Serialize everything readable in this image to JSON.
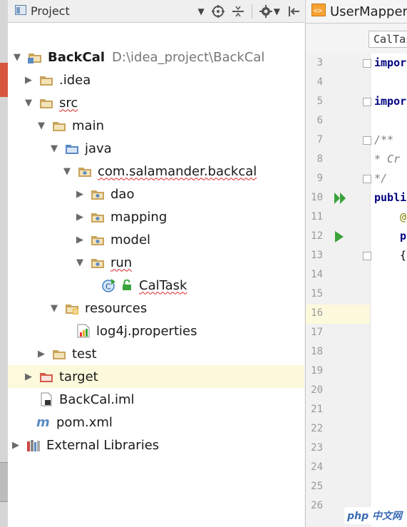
{
  "project_panel": {
    "title": "Project",
    "header_icons": [
      "dropdown-caret",
      "locate-icon",
      "collapse-icon",
      "gear-icon",
      "hide-icon"
    ]
  },
  "tree": [
    {
      "label": "BackCal",
      "path": "D:\\idea_project\\BackCal",
      "icon": "module-folder",
      "expanded": true,
      "bold": true
    },
    {
      "label": ".idea",
      "icon": "folder",
      "expanded": false
    },
    {
      "label": "src",
      "icon": "folder",
      "expanded": true,
      "squiggle": true
    },
    {
      "label": "main",
      "icon": "folder",
      "expanded": true
    },
    {
      "label": "java",
      "icon": "source-folder",
      "expanded": true
    },
    {
      "label": "com.salamander.backcal",
      "icon": "package",
      "expanded": true,
      "squiggle": true
    },
    {
      "label": "dao",
      "icon": "package",
      "expanded": false
    },
    {
      "label": "mapping",
      "icon": "package",
      "expanded": false
    },
    {
      "label": "model",
      "icon": "package",
      "expanded": false
    },
    {
      "label": "run",
      "icon": "package",
      "expanded": true,
      "squiggle": true
    },
    {
      "label": "CalTask",
      "icon": "class",
      "squiggle": true
    },
    {
      "label": "resources",
      "icon": "resources-folder",
      "expanded": true
    },
    {
      "label": "log4j.properties",
      "icon": "properties-file"
    },
    {
      "label": "test",
      "icon": "folder",
      "expanded": false
    },
    {
      "label": "target",
      "icon": "excluded-folder",
      "expanded": false,
      "selected": true
    },
    {
      "label": "BackCal.iml",
      "icon": "iml-file"
    },
    {
      "label": "pom.xml",
      "icon": "maven-file"
    },
    {
      "label": "External Libraries",
      "icon": "libraries",
      "expanded": false
    }
  ],
  "editor": {
    "tab_label": "UserMapper",
    "breadcrumb": "CalTas",
    "line_numbers": [
      "3",
      "4",
      "5",
      "6",
      "7",
      "8",
      "9",
      "10",
      "11",
      "12",
      "13",
      "14",
      "15",
      "16",
      "17",
      "18",
      "19",
      "20",
      "21",
      "22",
      "23",
      "24",
      "25",
      "26"
    ],
    "code": {
      "line3": "impor",
      "line5": "impor",
      "line7": "/**",
      "line8": " * Cr",
      "line9": " */",
      "line10": "publi",
      "line11": "@",
      "line12": "p",
      "line13": "{"
    }
  },
  "watermark": "php 中文网",
  "colors": {
    "folder": "#c9a45c",
    "selection": "#fdf9dc",
    "squiggle": "#dd2222",
    "keyword": "#000080"
  }
}
